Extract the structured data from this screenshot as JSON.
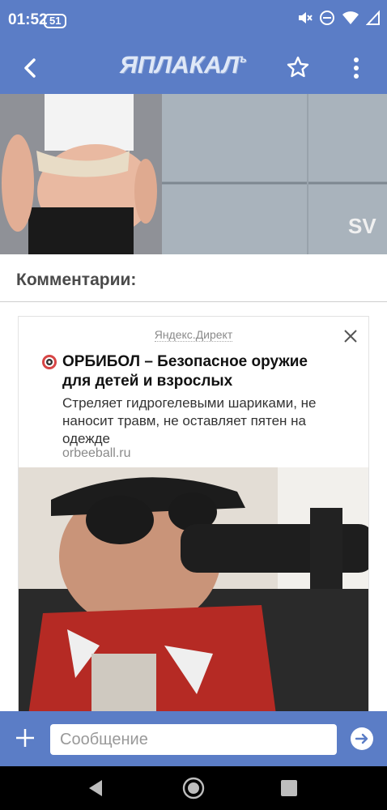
{
  "status": {
    "time": "01:52",
    "battery": "51"
  },
  "app_bar": {
    "logo": "ЯПЛАКАЛ",
    "logo_suffix": "ъ"
  },
  "hero": {
    "watermark": "SV"
  },
  "comments": {
    "title": "Комментарии:"
  },
  "ad": {
    "source": "Яндекс.Директ",
    "title": "ОРБИБОЛ – Безопасное оружие для детей и взрослых",
    "description": "Стреляет гидрогелевыми шариками, не наносит травм, не оставляет пятен на одежде",
    "domain": "orbeeball.ru"
  },
  "composer": {
    "placeholder": "Сообщение"
  },
  "colors": {
    "brand": "#5b7dc6",
    "nav_bar": "#000000"
  }
}
